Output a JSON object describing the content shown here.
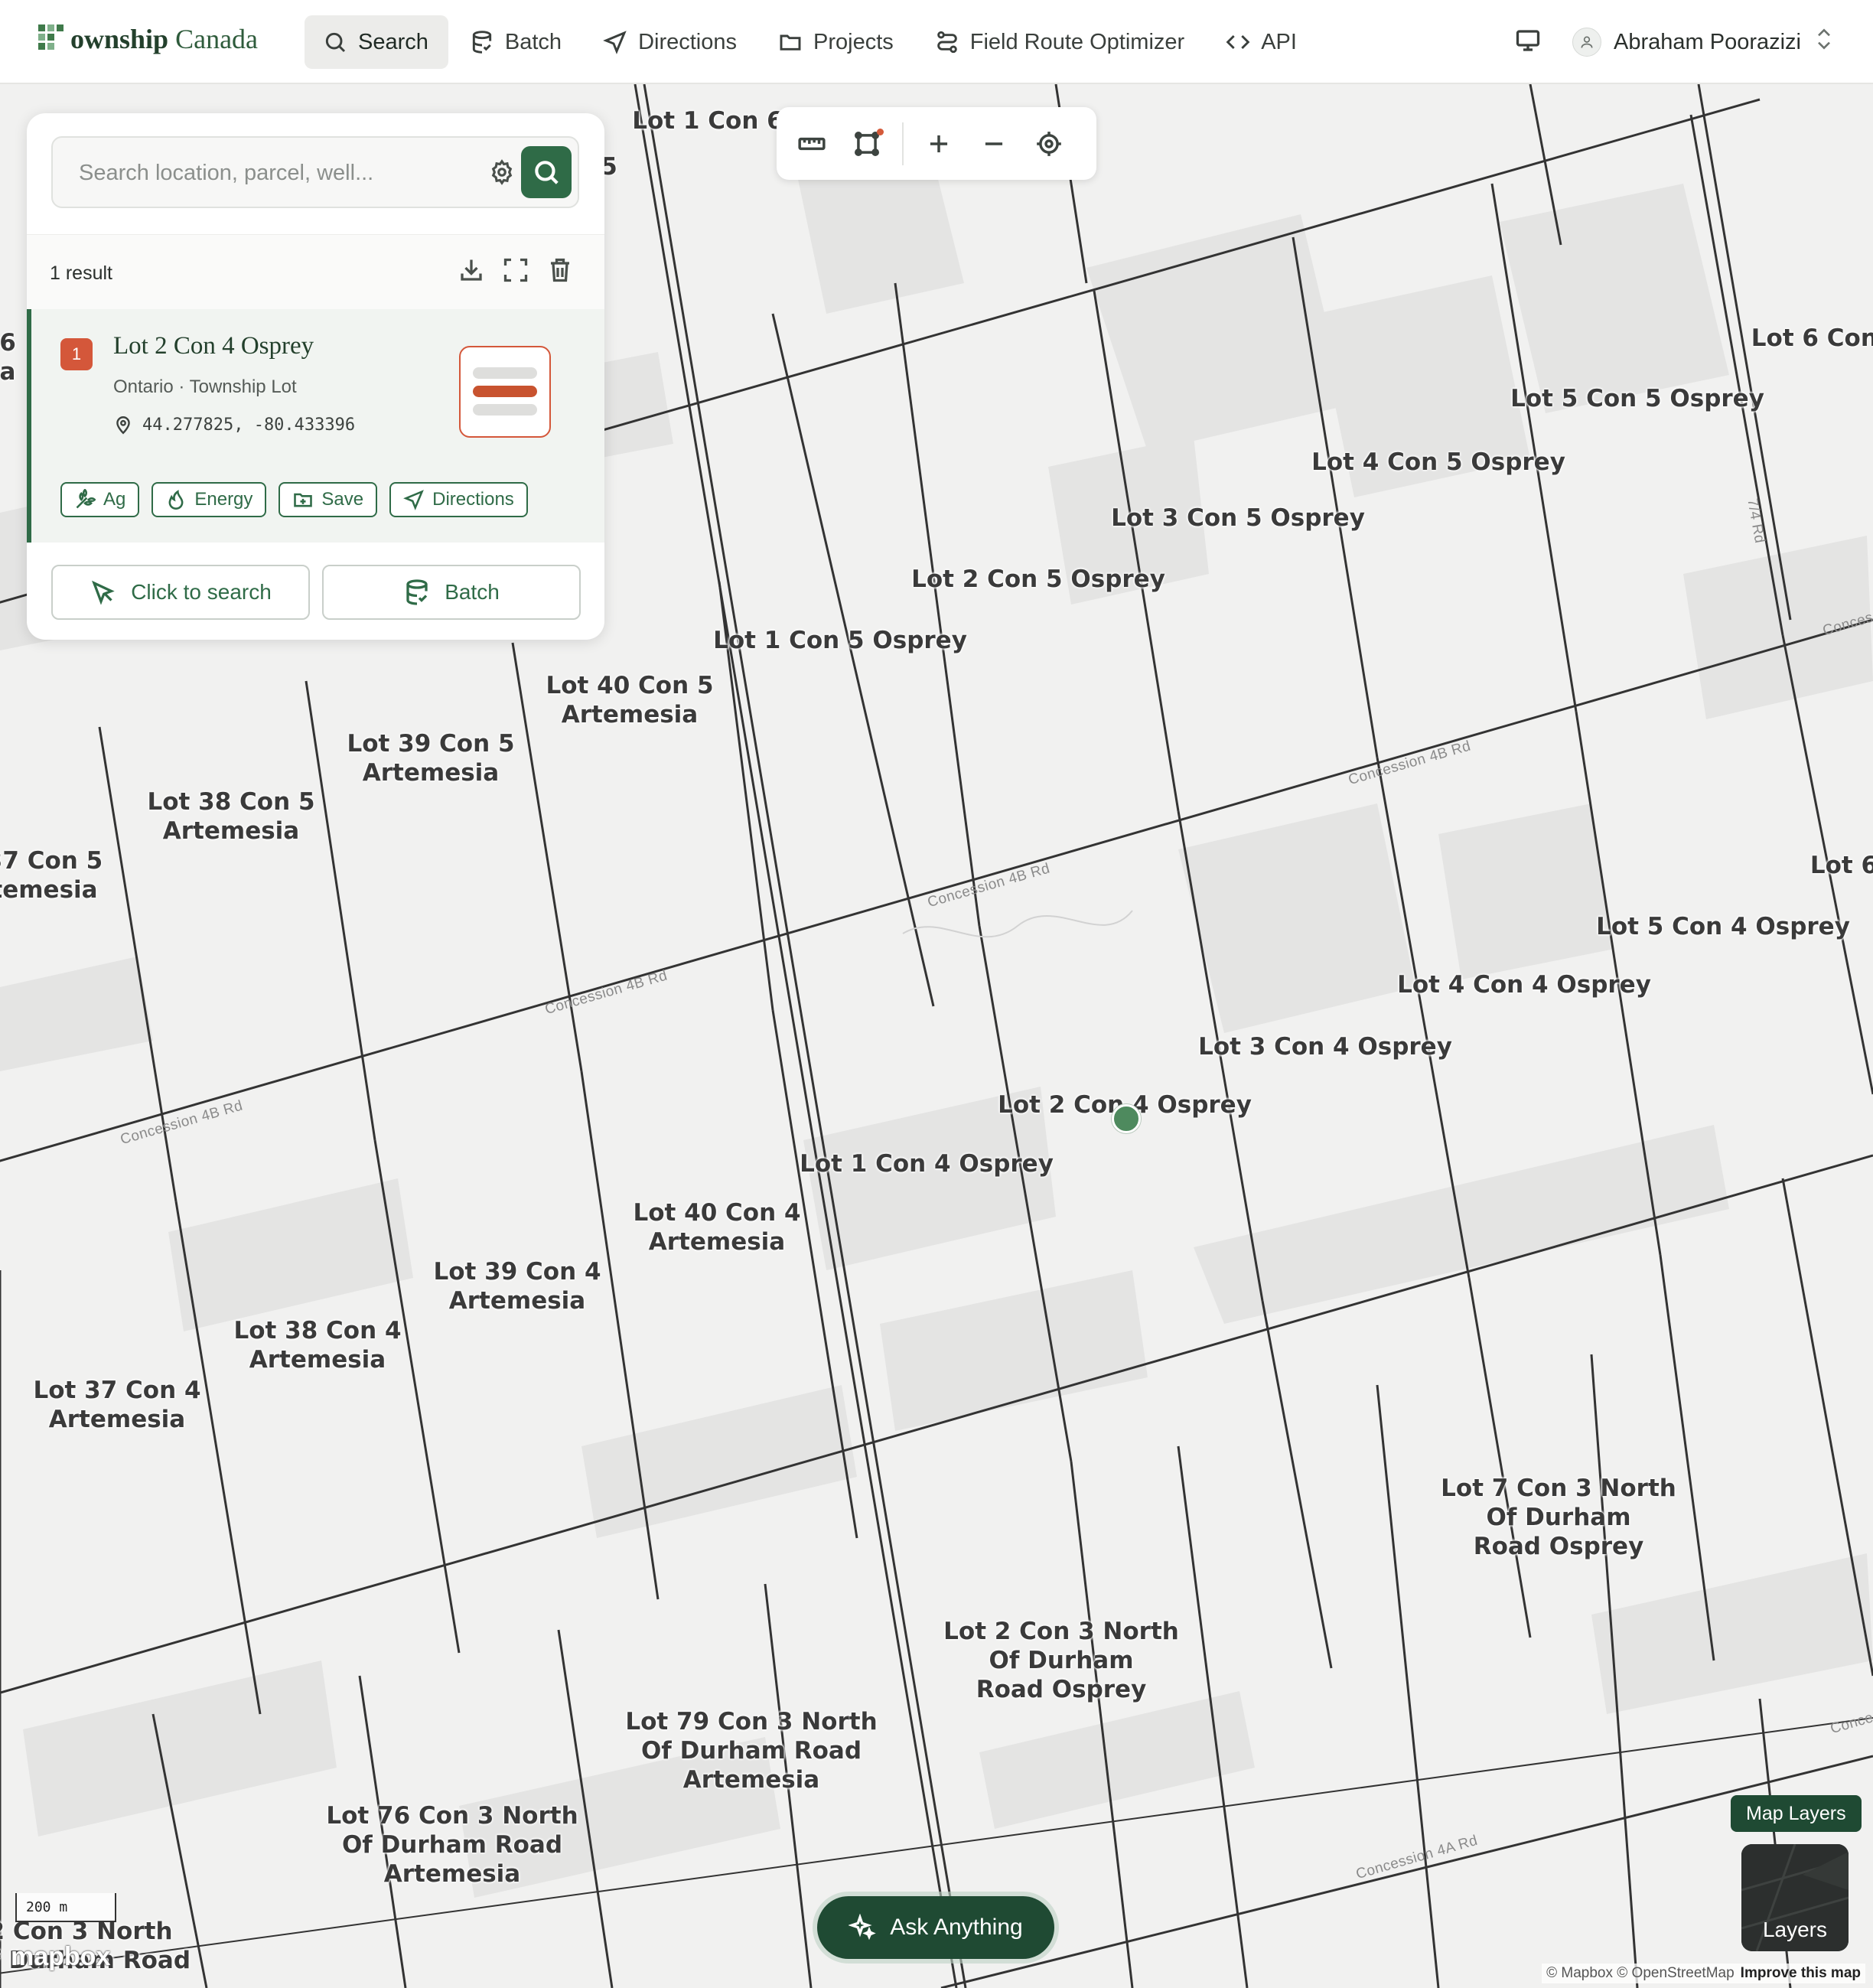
{
  "app": {
    "brand": "ownship Canada",
    "brand_bold": "ownship",
    "brand_rest": " Canada"
  },
  "nav": {
    "items": [
      {
        "label": "Search",
        "icon": "search-icon",
        "active": true
      },
      {
        "label": "Batch",
        "icon": "database-icon",
        "active": false
      },
      {
        "label": "Directions",
        "icon": "navigation-arrow-icon",
        "active": false
      },
      {
        "label": "Projects",
        "icon": "folder-icon",
        "active": false
      },
      {
        "label": "Field Route Optimizer",
        "icon": "route-icon",
        "active": false
      },
      {
        "label": "API",
        "icon": "code-icon",
        "active": false
      }
    ],
    "user_name": "Abraham Poorazizi"
  },
  "search": {
    "placeholder": "Search location, parcel, well...",
    "value": ""
  },
  "results": {
    "count_label": "1 result",
    "items": [
      {
        "rank": "1",
        "title": "Lot 2 Con 4 Osprey",
        "subtitle": "Ontario · Township Lot",
        "coordinates": "44.277825, -80.433396",
        "chips": [
          "Ag",
          "Energy",
          "Save",
          "Directions"
        ]
      }
    ]
  },
  "panel_actions": {
    "click_to_search": "Click to search",
    "batch": "Batch"
  },
  "map": {
    "lot_labels": [
      "Lot 1 Con 6",
      "Lot 6 Con 5 (",
      "Lot 5 Con 5 Osprey",
      "Lot 4 Con 5 Osprey",
      "Lot 3 Con 5 Osprey",
      "Lot 2 Con 5 Osprey",
      "Lot 1 Con 5 Osprey",
      "Lot 40 Con 5\nArtemesia",
      "Lot 39 Con 5\nArtemesia",
      "Lot 38 Con 5\nArtemesia",
      "37 Con 5\ntemesia",
      "Lot 6",
      "Lot 5 Con 4 Osprey",
      "Lot 4 Con 4 Osprey",
      "Lot 3 Con 4 Osprey",
      "Lot 2 Con 4 Osprey",
      "Lot 1 Con 4 Osprey",
      "Lot 40 Con 4\nArtemesia",
      "Lot 39 Con 4\nArtemesia",
      "Lot 38 Con 4\nArtemesia",
      "Lot 37 Con 4\nArtemesia",
      "Lot 7 Con 3 North\nOf Durham\nRoad Osprey",
      "Lot 2 Con 3 North\nOf Durham\nRoad Osprey",
      "Lot 79 Con 3 North\nOf Durham Road\nArtemesia",
      "Lot 76 Con 3 North\nOf Durham Road\nArtemesia",
      "2 Con 3 North\nOf Durham Road",
      "6\na",
      "5"
    ],
    "road_label": "Concession 4B Rd",
    "road_label_2": "Concession 4A Rd",
    "road_label_short": "Conces",
    "side_road_label": "7/4 Rd"
  },
  "bottom": {
    "ask_label": "Ask Anything",
    "map_layers_tag": "Map Layers",
    "layers_label": "Layers",
    "scale_label": "200 m",
    "mapbox_logo": "mapbox",
    "attribution": "© Mapbox © OpenStreetMap",
    "improve": "Improve this map"
  },
  "colors": {
    "accent": "#2f6b47",
    "accent_dark": "#1f4a33",
    "rank_badge": "#d4573a",
    "pin": "#4e8a5e"
  }
}
